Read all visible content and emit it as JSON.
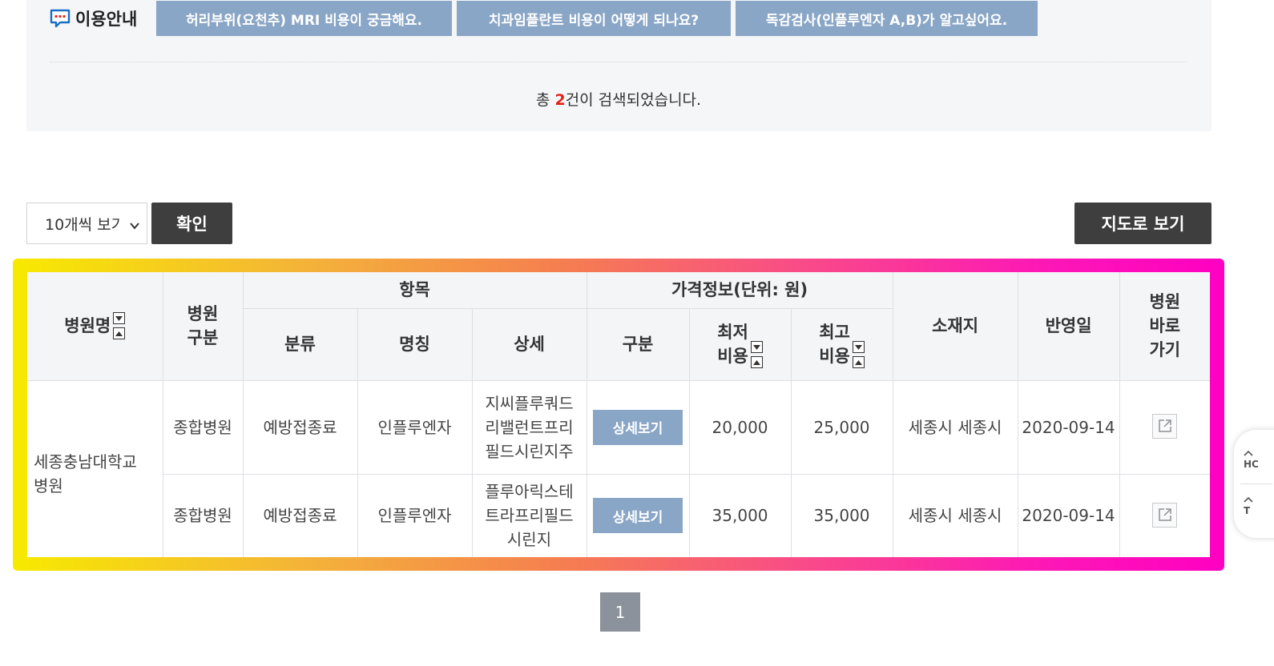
{
  "guide": {
    "label": "이용안내"
  },
  "faq": [
    {
      "label": "허리부위(요천추) MRI 비용이 궁금해요."
    },
    {
      "label": "치과임플란트 비용이 어떻게 되나요?"
    },
    {
      "label": "독감검사(인플루엔자 A,B)가 알고싶어요."
    }
  ],
  "result": {
    "prefix": "총 ",
    "count": "2",
    "suffix": "건이 검색되었습니다."
  },
  "controls": {
    "page_size_selected": "10개씩 보기",
    "confirm_label": "확인",
    "map_label": "지도로 보기"
  },
  "table": {
    "headers": {
      "hospital_name": "병원명",
      "hospital_type": [
        "병원",
        "구분"
      ],
      "item_group": "항목",
      "price_group": "가격정보(단위: 원)",
      "category": "분류",
      "name": "명칭",
      "detail": "상세",
      "division": "구분",
      "min_cost": [
        "최저",
        "비용"
      ],
      "max_cost": [
        "최고",
        "비용"
      ],
      "location": "소재지",
      "updated": "반영일",
      "shortcut": [
        "병원",
        "바로",
        "가기"
      ]
    },
    "hospital_name": [
      "세종충남대학교",
      "병원"
    ],
    "rows": [
      {
        "type": "종합병원",
        "category": "예방접종료",
        "name": "인플루엔자",
        "detail": [
          "지씨플루쿼드",
          "리밸런트프리",
          "필드시린지주"
        ],
        "button": "상세보기",
        "min": "20,000",
        "max": "25,000",
        "location": "세종시 세종시",
        "date": "2020-09-14"
      },
      {
        "type": "종합병원",
        "category": "예방접종료",
        "name": "인플루엔자",
        "detail": [
          "플루아릭스테",
          "트라프리필드",
          "시린지"
        ],
        "button": "상세보기",
        "min": "35,000",
        "max": "35,000",
        "location": "세종시 세종시",
        "date": "2020-09-14"
      }
    ]
  },
  "pagination": {
    "current": "1"
  },
  "side": {
    "home": "HC",
    "top": "T"
  },
  "colors": {
    "accent_blue": "#8aa6c6",
    "dark_button": "#3e3e3e",
    "count_red": "#e2231a",
    "panel_bg": "#f5f6f8"
  },
  "icons": {
    "guide": "chat-bubble-icon",
    "sort_down": "sort-down-icon",
    "sort_up": "sort-up-icon",
    "shortcut": "external-link-icon",
    "select": "chevron-down-icon"
  }
}
